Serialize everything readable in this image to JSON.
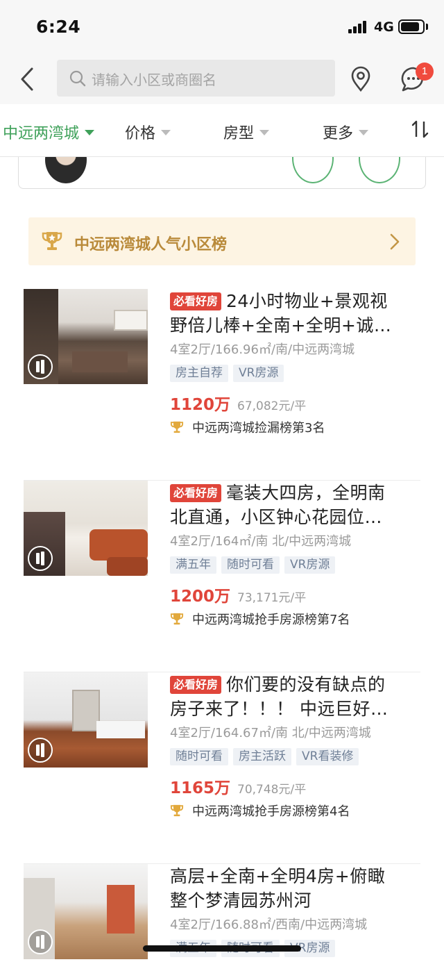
{
  "status_bar": {
    "time": "6:24",
    "network": "4G"
  },
  "search": {
    "placeholder": "请输入小区或商圈名"
  },
  "notifications": {
    "badge_count": "1"
  },
  "filters": {
    "area": "中远两湾城",
    "price": "价格",
    "layout": "房型",
    "more": "更多"
  },
  "ranking_banner": {
    "text": "中远两湾城人气小区榜"
  },
  "listings": [
    {
      "badge": "必看好房",
      "title_line1": "24小时物业+景观视",
      "title_line2": "野倍儿棒+全南+全明+诚…",
      "meta": "4室2厅/166.96㎡/南/中远两湾城",
      "tags": [
        "房主自荐",
        "VR房源"
      ],
      "price": "1120万",
      "unit_price": "67,082元/平",
      "rank": "中远两湾城捡漏榜第3名"
    },
    {
      "badge": "必看好房",
      "title_line1": "毫装大四房，全明南",
      "title_line2": "北直通，小区钟心花园位…",
      "meta": "4室2厅/164㎡/南 北/中远两湾城",
      "tags": [
        "满五年",
        "随时可看",
        "VR房源"
      ],
      "price": "1200万",
      "unit_price": "73,171元/平",
      "rank": "中远两湾城抢手房源榜第7名"
    },
    {
      "badge": "必看好房",
      "title_line1": "你们要的没有缺点的",
      "title_line2": "房子来了！！！ 中远巨好…",
      "meta": "4室2厅/164.67㎡/南 北/中远两湾城",
      "tags": [
        "随时可看",
        "房主活跃",
        "VR看装修"
      ],
      "price": "1165万",
      "unit_price": "70,748元/平",
      "rank": "中远两湾城抢手房源榜第4名"
    },
    {
      "badge": "",
      "title_line1": "高层+全南+全明4房+俯瞰",
      "title_line2": "整个梦清园苏州河",
      "meta": "4室2厅/166.88㎡/西南/中远两湾城",
      "tags": [
        "满五年",
        "随时可看",
        "VR房源"
      ],
      "price": "",
      "unit_price": "",
      "rank": ""
    }
  ],
  "colors": {
    "accent_green": "#3fa15a",
    "price_red": "#e0453a",
    "badge_red": "#f04b3e",
    "banner_gold": "#b98a3a"
  },
  "icons": [
    "back-icon",
    "search-icon",
    "location-icon",
    "message-icon",
    "sort-icon",
    "trophy-icon",
    "vr-icon",
    "chevron-right-icon"
  ]
}
